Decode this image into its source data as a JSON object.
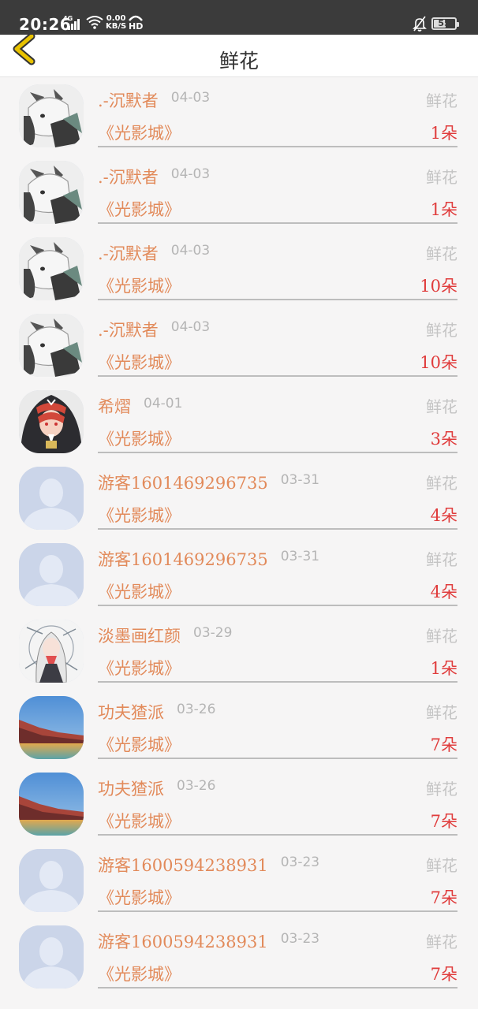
{
  "status_bar": {
    "time": "20:26",
    "network": "4G",
    "speed_value": "0.00",
    "speed_unit": "KB/S",
    "hd": "HD",
    "battery": "55"
  },
  "header": {
    "title": "鲜花"
  },
  "items": [
    {
      "name": ".-沉默者",
      "date": "04-03",
      "type": "鲜花",
      "book": "《光影城》",
      "count": "1朵",
      "avatar": "anime-cat-ear"
    },
    {
      "name": ".-沉默者",
      "date": "04-03",
      "type": "鲜花",
      "book": "《光影城》",
      "count": "1朵",
      "avatar": "anime-cat-ear"
    },
    {
      "name": ".-沉默者",
      "date": "04-03",
      "type": "鲜花",
      "book": "《光影城》",
      "count": "10朵",
      "avatar": "anime-cat-ear"
    },
    {
      "name": ".-沉默者",
      "date": "04-03",
      "type": "鲜花",
      "book": "《光影城》",
      "count": "10朵",
      "avatar": "anime-cat-ear"
    },
    {
      "name": "希熠",
      "date": "04-01",
      "type": "鲜花",
      "book": "《光影城》",
      "count": "3朵",
      "avatar": "anime-hoodie"
    },
    {
      "name": "游客1601469296735",
      "date": "03-31",
      "type": "鲜花",
      "book": "《光影城》",
      "count": "4朵",
      "avatar": "default-person"
    },
    {
      "name": "游客1601469296735",
      "date": "03-31",
      "type": "鲜花",
      "book": "《光影城》",
      "count": "4朵",
      "avatar": "default-person"
    },
    {
      "name": "淡墨画红颜",
      "date": "03-29",
      "type": "鲜花",
      "book": "《光影城》",
      "count": "1朵",
      "avatar": "anime-white-hair"
    },
    {
      "name": "功夫猹派",
      "date": "03-26",
      "type": "鲜花",
      "book": "《光影城》",
      "count": "7朵",
      "avatar": "landscape"
    },
    {
      "name": "功夫猹派",
      "date": "03-26",
      "type": "鲜花",
      "book": "《光影城》",
      "count": "7朵",
      "avatar": "landscape"
    },
    {
      "name": "游客1600594238931",
      "date": "03-23",
      "type": "鲜花",
      "book": "《光影城》",
      "count": "7朵",
      "avatar": "default-person"
    },
    {
      "name": "游客1600594238931",
      "date": "03-23",
      "type": "鲜花",
      "book": "《光影城》",
      "count": "7朵",
      "avatar": "default-person"
    }
  ],
  "colors": {
    "accent": "#e28a5a",
    "count": "#e03c3c",
    "back_arrow": "#e8c200"
  }
}
